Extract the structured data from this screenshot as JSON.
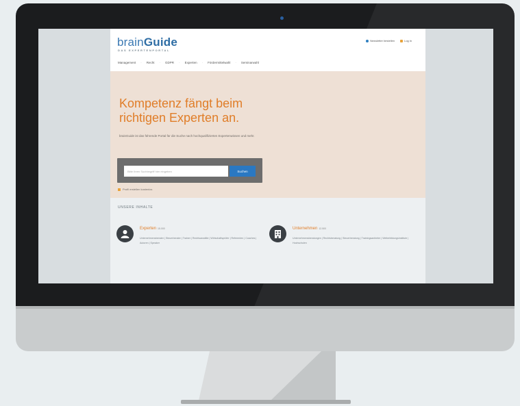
{
  "logo": {
    "brain": "brain",
    "guide": "Guide",
    "tagline": "DAS EXPERTENPORTAL"
  },
  "header_links": {
    "newsletter": "Newsletter bestellen",
    "login": "Log in"
  },
  "nav": {
    "items": [
      "Management",
      "Recht",
      "GDPR",
      "Experten",
      "Fördermittelwahl",
      "Seminarwahl"
    ]
  },
  "hero": {
    "title": "Kompetenz fängt beim richtigen Experten an.",
    "subtitle": "brainGuide ist das führende Portal für die Suche nach hochqualifizierten Expertenwissen und mehr.",
    "search_placeholder": "Bitte Ihren Suchbegriff hier eingeben",
    "search_button": "Suchen",
    "hint": "Profil erstellen kostenlos"
  },
  "content": {
    "section_title": "UNSERE INHALTE",
    "experts": {
      "title": "Experten",
      "count": "15.000",
      "text": "Unternehmensberater | Steuerberater | Trainer | Rechtsanwälte | Wirtschaftsprüfer | Referenten | Coaches | Autoren | Speaker"
    },
    "companies": {
      "title": "Unternehmen",
      "count": "12.500",
      "text": "Unternehmensberatungen | Rechtsberatung | Steuerberatung | Trainingsanbieter | Weiterbildungsinstitute | Hochschulen"
    }
  },
  "colors": {
    "accent_orange": "#e07d28",
    "brand_blue": "#2e6da4",
    "button_blue": "#2a78c2",
    "hero_bg": "#eee0d5"
  }
}
